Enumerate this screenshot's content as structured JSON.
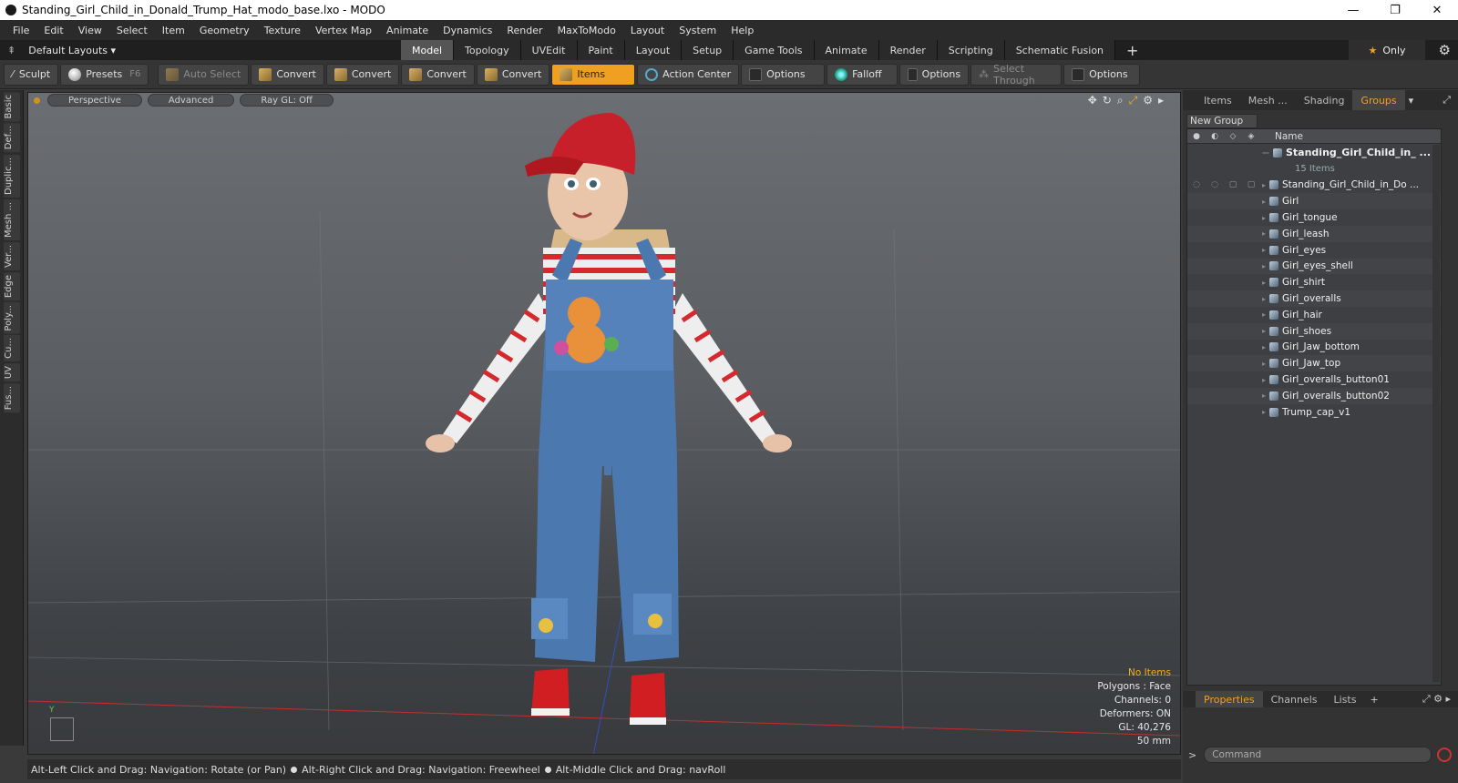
{
  "window": {
    "title": "Standing_Girl_Child_in_Donald_Trump_Hat_modo_base.lxo - MODO",
    "controls": [
      "—",
      "❐",
      "✕"
    ]
  },
  "menu": [
    "File",
    "Edit",
    "View",
    "Select",
    "Item",
    "Geometry",
    "Texture",
    "Vertex Map",
    "Animate",
    "Dynamics",
    "Render",
    "MaxToModo",
    "Layout",
    "System",
    "Help"
  ],
  "layoutbar": {
    "layouts_label": "Default Layouts ▾",
    "tabs": [
      "Model",
      "Topology",
      "UVEdit",
      "Paint",
      "Layout",
      "Setup",
      "Game Tools",
      "Animate",
      "Render",
      "Scripting",
      "Schematic Fusion"
    ],
    "active_tab": "Model",
    "plus": "+",
    "only_label": "Only"
  },
  "toolbar": {
    "sculpt": "Sculpt",
    "presets": "Presets",
    "presets_key": "F6",
    "auto_select": "Auto Select",
    "convert1": "Convert",
    "convert2": "Convert",
    "convert3": "Convert",
    "convert4": "Convert",
    "items": "Items",
    "action_center": "Action Center",
    "options1": "Options",
    "falloff": "Falloff",
    "options2": "Options",
    "select_through": "Select Through",
    "options3": "Options"
  },
  "lefttabs": [
    "Basic",
    "Def...",
    "Duplic...",
    "Mesh ...",
    "Ver...",
    "Edge",
    "Poly...",
    "Cu...",
    "UV",
    "Fus..."
  ],
  "viewport": {
    "view_mode": "Perspective",
    "shading": "Advanced",
    "raygl": "Ray GL: Off",
    "axis_y": "Y",
    "stats": {
      "selection": "No Items",
      "polygons": "Polygons : Face",
      "channels": "Channels: 0",
      "deformers": "Deformers: ON",
      "gl": "GL: 40,276",
      "scale": "50 mm"
    },
    "colors": {
      "cap": "#c8202a",
      "shirt_stripe": "#d42a2e",
      "overalls": "#4c78b0",
      "shoes": "#d01e22"
    }
  },
  "statusbar": {
    "hint1": "Alt-Left Click and Drag: Navigation: Rotate (or Pan)",
    "hint2": "Alt-Right Click and Drag: Navigation: Freewheel",
    "hint3": "Alt-Middle Click and Drag: navRoll"
  },
  "rightpanel": {
    "tabs": [
      "Items",
      "Mesh ...",
      "Shading",
      "Groups"
    ],
    "active_tab": "Groups",
    "new_group": "New Group",
    "name_header": "Name",
    "root": {
      "name": "Standing_Girl_Child_in_ ...",
      "count": "15 Items"
    },
    "items": [
      "Standing_Girl_Child_in_Do ...",
      "Girl",
      "Girl_tongue",
      "Girl_leash",
      "Girl_eyes",
      "Girl_eyes_shell",
      "Girl_shirt",
      "Girl_overalls",
      "Girl_hair",
      "Girl_shoes",
      "Girl_Jaw_bottom",
      "Girl_Jaw_top",
      "Girl_overalls_button01",
      "Girl_overalls_button02",
      "Trump_cap_v1"
    ],
    "bottom_tabs": [
      "Properties",
      "Channels",
      "Lists"
    ],
    "bottom_active": "Properties",
    "bottom_plus": "+",
    "command_placeholder": "Command"
  }
}
